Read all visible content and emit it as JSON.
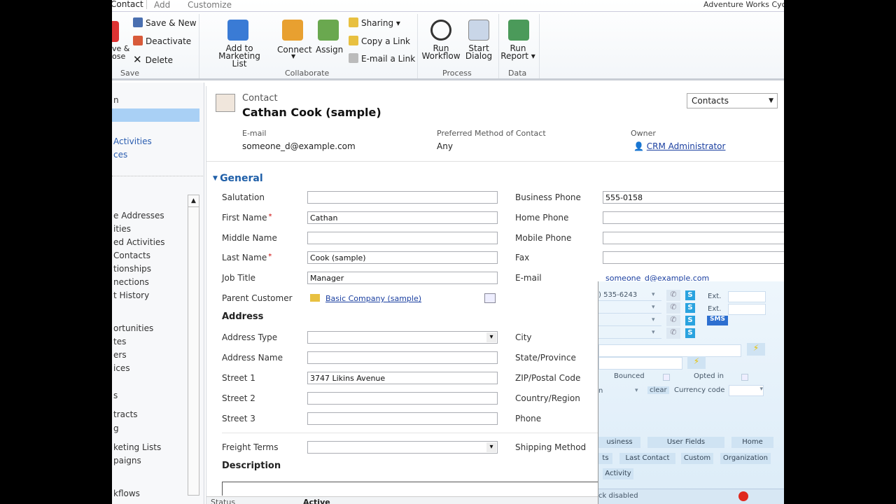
{
  "app_title": "Adventure Works Cyc",
  "tabs": [
    "Contact",
    "Add",
    "Customize"
  ],
  "ribbon": {
    "save_close": "ve &\nose",
    "save_new": "Save & New",
    "deactivate": "Deactivate",
    "delete": "Delete",
    "save_group": "Save",
    "add_marketing": "Add to Marketing",
    "add_marketing2": "List",
    "connect": "Connect",
    "assign": "Assign",
    "sharing": "Sharing",
    "copy_link": "Copy a Link",
    "email_link": "E-mail a Link",
    "collaborate_group": "Collaborate",
    "run_workflow": "Run",
    "run_workflow2": "Workflow",
    "start_dialog": "Start",
    "start_dialog2": "Dialog",
    "process_group": "Process",
    "run_report": "Run",
    "run_report2": "Report",
    "data_group": "Data"
  },
  "nav": {
    "top": [
      "n",
      "",
      "Activities",
      "ces"
    ],
    "items": [
      "e Addresses",
      "ities",
      "ed Activities",
      "Contacts",
      "tionships",
      "nections",
      "t History",
      "ortunities",
      "tes",
      "ers",
      "ices",
      "s",
      "tracts",
      "g",
      "keting Lists",
      "paigns",
      "kflows"
    ]
  },
  "header": {
    "entity": "Contact",
    "name": "Cathan Cook (sample)",
    "view_select": "Contacts",
    "email_label": "E-mail",
    "email": "someone_d@example.com",
    "pmc_label": "Preferred Method of Contact",
    "pmc": "Any",
    "owner_label": "Owner",
    "owner": "CRM Administrator"
  },
  "general": {
    "title": "General",
    "left": [
      {
        "label": "Salutation",
        "value": ""
      },
      {
        "label": "First Name",
        "value": "Cathan",
        "req": "*"
      },
      {
        "label": "Middle Name",
        "value": ""
      },
      {
        "label": "Last Name",
        "value": "Cook (sample)",
        "req": "*"
      },
      {
        "label": "Job Title",
        "value": "Manager"
      },
      {
        "label": "Parent Customer",
        "value": "Basic Company (sample)"
      }
    ],
    "right": [
      {
        "label": "Business Phone",
        "value": "555-0158"
      },
      {
        "label": "Home Phone",
        "value": ""
      },
      {
        "label": "Mobile Phone",
        "value": ""
      },
      {
        "label": "Fax",
        "value": ""
      },
      {
        "label": "E-mail",
        "value": "someone_d@example.com"
      }
    ]
  },
  "address": {
    "title": "Address",
    "left": [
      {
        "label": "Address Type",
        "value": ""
      },
      {
        "label": "Address Name",
        "value": ""
      },
      {
        "label": "Street 1",
        "value": "3747 Likins Avenue"
      },
      {
        "label": "Street 2",
        "value": ""
      },
      {
        "label": "Street 3",
        "value": ""
      }
    ],
    "right": [
      "City",
      "State/Province",
      "ZIP/Postal Code",
      "Country/Region",
      "Phone"
    ],
    "freight_label": "Freight Terms",
    "shipping_label": "Shipping Method"
  },
  "description_title": "Description",
  "footer": {
    "status_label": "Status",
    "status": "Active"
  },
  "overlay": {
    "phone": ") 535-6243",
    "ext": "Ext.",
    "sms": "SMS",
    "s": "S",
    "bounced": "Bounced",
    "opted_in": "Opted in",
    "clear": "clear",
    "currency": "Currency code",
    "n": "n",
    "tabs1": [
      "usiness",
      "User Fields",
      "Home"
    ],
    "tabs2": [
      "ts",
      "Last Contact",
      "Custom",
      "Organization"
    ],
    "tabs3": [
      "Activity"
    ],
    "status": "ck disabled"
  }
}
